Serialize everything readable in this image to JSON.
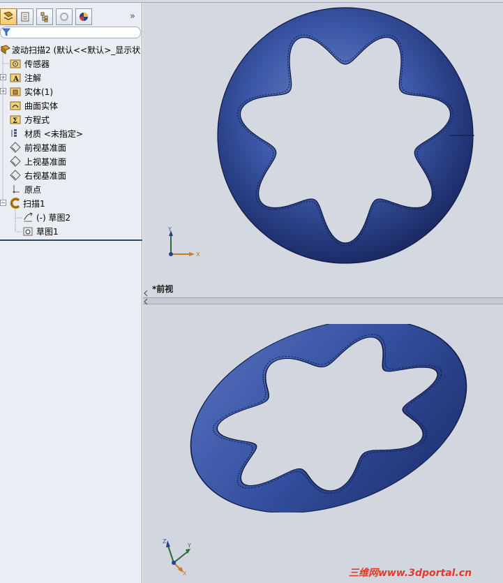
{
  "feature_tree": {
    "root": {
      "label": "波动扫描2  (默认<<默认>_显示状"
    },
    "items": [
      {
        "label": "传感器",
        "icon": "sensor-icon",
        "expandable": false
      },
      {
        "label": "注解",
        "icon": "annotation-icon",
        "expandable": true
      },
      {
        "label": "实体(1)",
        "icon": "solid-body-folder-icon",
        "expandable": true
      },
      {
        "label": "曲面实体",
        "icon": "surface-body-folder-icon",
        "expandable": false
      },
      {
        "label": "方程式",
        "icon": "equation-icon",
        "expandable": false
      },
      {
        "label": "材质 <未指定>",
        "icon": "material-icon",
        "expandable": false
      },
      {
        "label": "前视基准面",
        "icon": "plane-icon",
        "expandable": false
      },
      {
        "label": "上视基准面",
        "icon": "plane-icon",
        "expandable": false
      },
      {
        "label": "右视基准面",
        "icon": "plane-icon",
        "expandable": false
      },
      {
        "label": "原点",
        "icon": "origin-icon",
        "expandable": false
      },
      {
        "label": "扫描1",
        "icon": "sweep-icon",
        "expandable": true,
        "expanded": true
      },
      {
        "label": "(-) 草图2",
        "icon": "sketch-icon",
        "child": true
      },
      {
        "label": "草图1",
        "icon": "sketch-icon",
        "child": true
      }
    ]
  },
  "viewport": {
    "top_view_label": "*前视",
    "triad_top": {
      "y": "Y",
      "x": "X"
    },
    "triad_bottom": {
      "z": "Z",
      "y": "Y",
      "x": "X"
    },
    "model_color": "#2c4590",
    "background_color": "#d4d8e0"
  },
  "watermark": "三维网www.3dportal.cn"
}
